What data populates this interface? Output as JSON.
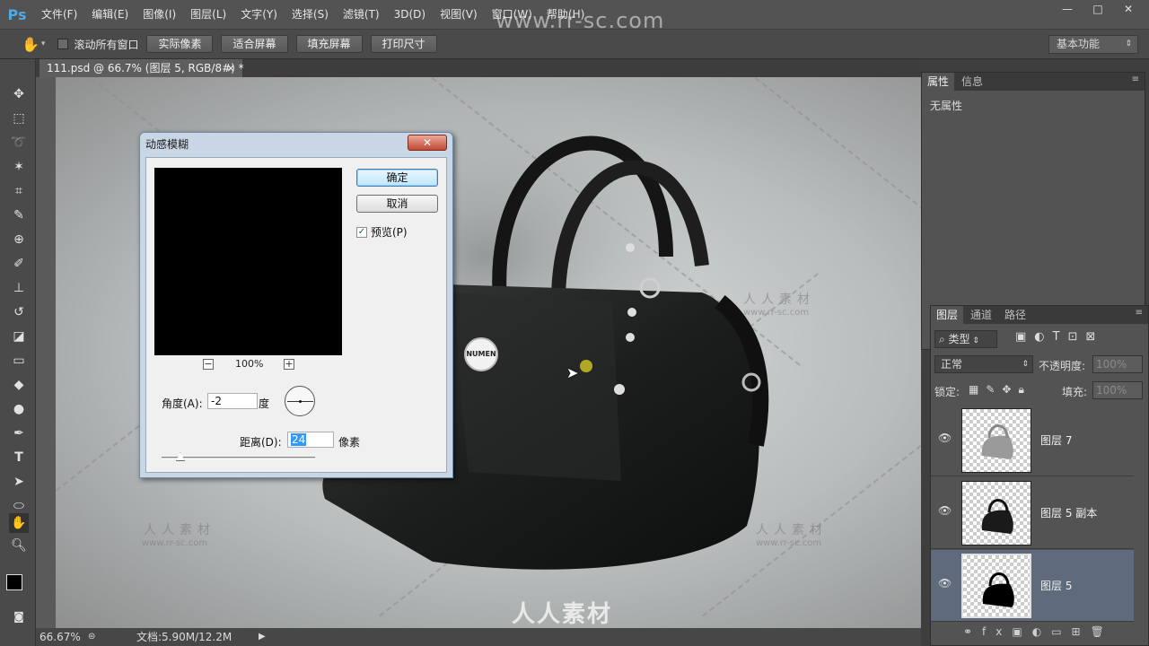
{
  "app": {
    "logo": "Ps"
  },
  "menu": [
    "文件(F)",
    "编辑(E)",
    "图像(I)",
    "图层(L)",
    "文字(Y)",
    "选择(S)",
    "滤镜(T)",
    "3D(D)",
    "视图(V)",
    "窗口(W)",
    "帮助(H)"
  ],
  "watermark_url": "www.rr-sc.com",
  "window_controls": {
    "minimize": "—",
    "maximize": "□",
    "close": "✕"
  },
  "options": {
    "scroll_all": "滚动所有窗口",
    "actual_pixels": "实际像素",
    "fit_screen": "适合屏幕",
    "fill_screen": "填充屏幕",
    "print_size": "打印尺寸",
    "workspace": "基本功能"
  },
  "document": {
    "tab_title": "111.psd @ 66.7% (图层 5, RGB/8#) *",
    "close": "×"
  },
  "canvas": {
    "watermark_cn": "人人素材",
    "watermark_en": "www.rr-sc.com",
    "badge_text": "NUMEN",
    "bottom_logo": "人人素材"
  },
  "status": {
    "zoom": "66.67%",
    "doc_info": "文档:5.90M/12.2M"
  },
  "properties_panel": {
    "tabs": [
      "属性",
      "信息"
    ],
    "content": "无属性"
  },
  "layers_panel": {
    "tabs": [
      "图层",
      "通道",
      "路径"
    ],
    "filter_kind": "类型",
    "blend_mode": "正常",
    "opacity_label": "不透明度:",
    "opacity_value": "100%",
    "lock_label": "锁定:",
    "fill_label": "填充:",
    "fill_value": "100%",
    "layers": [
      {
        "name": "图层 7",
        "selected": false
      },
      {
        "name": "图层 5 副本",
        "selected": false
      },
      {
        "name": "图层 5",
        "selected": true
      }
    ]
  },
  "dialog": {
    "title": "动感模糊",
    "ok": "确定",
    "cancel": "取消",
    "preview_label": "预览(P)",
    "preview_checked": true,
    "zoom": "100%",
    "angle_label": "角度(A):",
    "angle_value": "-2",
    "angle_unit": "度",
    "distance_label": "距离(D):",
    "distance_value": "24",
    "distance_unit": "像素"
  },
  "colors": {
    "ps_blue": "#4fa8e8",
    "selected_layer": "#5f6b7c"
  }
}
